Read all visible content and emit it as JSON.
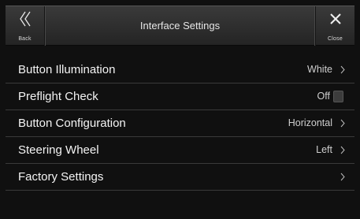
{
  "header": {
    "title": "Interface Settings",
    "back_label": "Back",
    "close_label": "Close",
    "back_icon": "double-chevron-left-icon",
    "close_icon": "close-x-icon"
  },
  "settings": [
    {
      "label": "Button Illumination",
      "value": "White"
    },
    {
      "label": "Preflight Check",
      "value": "Off"
    },
    {
      "label": "Button Configuration",
      "value": "Horizontal"
    },
    {
      "label": "Steering Wheel",
      "value": "Left"
    },
    {
      "label": "Factory Settings",
      "value": ""
    }
  ],
  "colors": {
    "background": "#101010",
    "header_bar": "#2e2e2e",
    "text": "#f4f4f4",
    "value_text": "#cfcfcf",
    "divider": "#3a3a3a"
  }
}
